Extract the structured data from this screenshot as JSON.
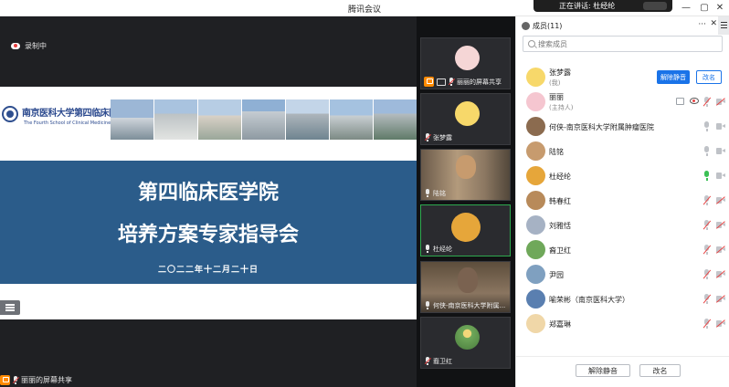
{
  "window": {
    "title": "腾讯会议",
    "speaking_indicator": "正在讲话: 杜经纶",
    "controls": {
      "minimize": "—",
      "maximize": "▢",
      "close": "✕"
    }
  },
  "main": {
    "recording_label": "录制中",
    "slide": {
      "school_name": "南京医科大学第四临床医学院",
      "school_sub": "The Fourth School of Clinical Medicine",
      "title_line1": "第四临床医学院",
      "title_line2": "培养方案专家指导会",
      "date": "二〇二二年十二月二十日"
    },
    "share_label": "丽丽的屏幕共享"
  },
  "thumbnails": [
    {
      "name": "丽丽的屏幕共享",
      "type": "avatar",
      "avatar_color": "#f5d6d6",
      "muted": true,
      "sharing": true
    },
    {
      "name": "张梦露",
      "type": "avatar",
      "avatar_color": "#f7d86a",
      "muted": true,
      "sharing": false
    },
    {
      "name": "陆铭",
      "type": "video",
      "avatar_color": "#c79b6e",
      "muted": false,
      "sharing": false
    },
    {
      "name": "杜经纶",
      "type": "avatar",
      "avatar_color": "#e6a63a",
      "muted": false,
      "sharing": false,
      "active": true
    },
    {
      "name": "何侠-南京医科大学附属...",
      "type": "video",
      "avatar_color": "#8b6b4f",
      "muted": false,
      "sharing": false
    },
    {
      "name": "裔卫红",
      "type": "avatar",
      "avatar_color": "#6fa85a",
      "muted": true,
      "sharing": false
    }
  ],
  "panel": {
    "title": "成员(11)",
    "more_icon": "···",
    "close_icon": "✕",
    "search_placeholder": "搜索成员",
    "members": [
      {
        "name": "张梦露",
        "role": "(我)",
        "avatar_color": "#f7d86a",
        "buttons": [
          "解除静音",
          "改名"
        ],
        "mic": "none",
        "cam": "none"
      },
      {
        "name": "丽丽",
        "role": "(主持人)",
        "avatar_color": "#f5c6d0",
        "screen": true,
        "eye": true,
        "mic": "muted",
        "cam": "off"
      },
      {
        "name": "何侠-南京医科大学附属肿瘤医院",
        "role": "",
        "avatar_color": "#8b6b4f",
        "mic": "idle",
        "cam": "on"
      },
      {
        "name": "陆铭",
        "role": "",
        "avatar_color": "#c79b6e",
        "mic": "idle",
        "cam": "on"
      },
      {
        "name": "杜经纶",
        "role": "",
        "avatar_color": "#e6a63a",
        "mic": "on",
        "cam": "on"
      },
      {
        "name": "韩春红",
        "role": "",
        "avatar_color": "#b88a5a",
        "mic": "muted",
        "cam": "off"
      },
      {
        "name": "刘雅恬",
        "role": "",
        "avatar_color": "#a6b2c4",
        "mic": "muted",
        "cam": "off"
      },
      {
        "name": "裔卫红",
        "role": "",
        "avatar_color": "#6fa85a",
        "mic": "muted",
        "cam": "off"
      },
      {
        "name": "尹园",
        "role": "",
        "avatar_color": "#7fa0c0",
        "mic": "muted",
        "cam": "off"
      },
      {
        "name": "喻荣彬（南京医科大学）",
        "role": "",
        "avatar_color": "#5a7fb0",
        "mic": "muted",
        "cam": "off"
      },
      {
        "name": "郑嘉琳",
        "role": "",
        "avatar_color": "#f0d7a8",
        "mic": "muted",
        "cam": "off"
      }
    ],
    "footer_unmute": "解除静音",
    "footer_rename": "改名"
  },
  "colors": {
    "accent": "#1a73e8",
    "slide_band": "#2b5c8a",
    "speaking": "#3cc156",
    "muted": "#e84545"
  }
}
